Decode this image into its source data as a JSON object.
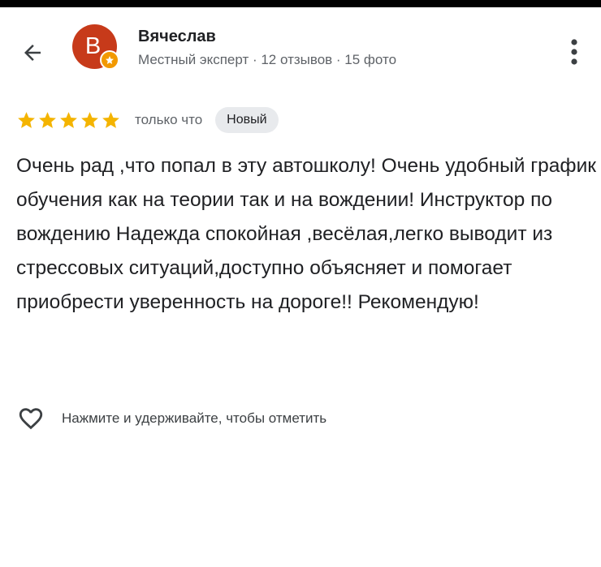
{
  "header": {
    "back_icon": "arrow-left-icon",
    "avatar_letter": "В",
    "avatar_color": "#c73a1a",
    "badge_color": "#f29900",
    "author_name": "Вячеслав",
    "author_meta": "Местный эксперт · 12 отзывов · 15 фото",
    "more_icon": "more-vert-icon"
  },
  "review": {
    "rating": 5,
    "rating_max": 5,
    "star_color": "#f4b400",
    "time": "только что",
    "badge": "Новый",
    "text": "Очень рад ,что попал в эту автошколу! Очень удобный график обучения как на теории так и на вождении! Инструктор по вождению Надежда спокойная ,весёлая,легко выводит из стрессовых ситуаций,доступно объясняет и помогает приобрести уверенность на дороге!! Рекомендую!"
  },
  "actions": {
    "like_icon": "heart-outline-icon",
    "like_hint": "Нажмите и удерживайте, чтобы отметить"
  }
}
